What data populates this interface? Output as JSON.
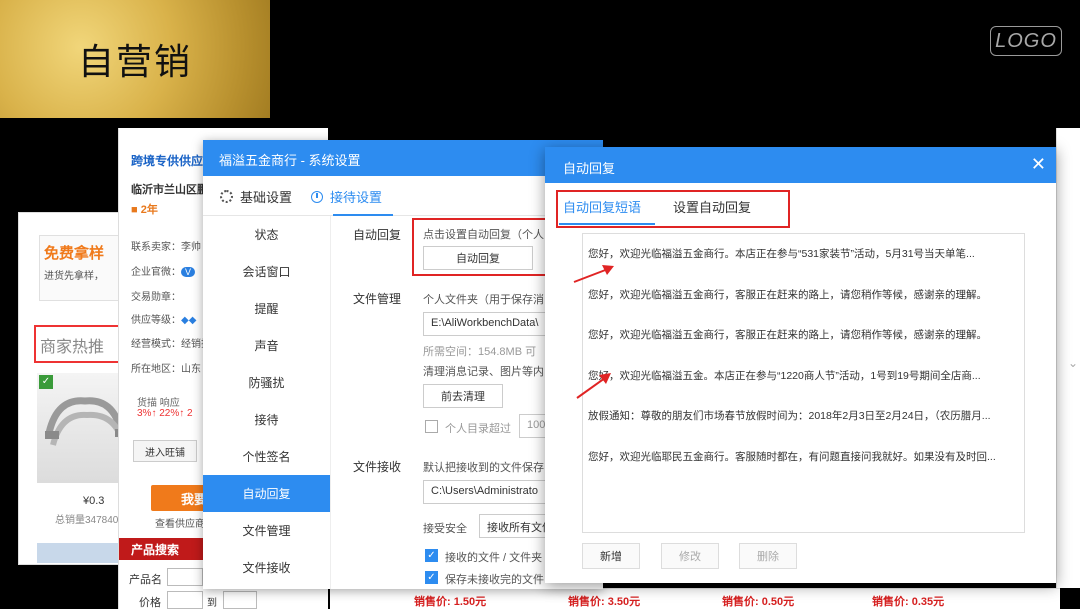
{
  "header": {
    "banner_title": "自营销",
    "logo": "LOGO"
  },
  "left_page": {
    "free_title": "免费拿样",
    "free_sub": "进货先拿样，",
    "hot_label": "商家热推",
    "price": "¥0.3",
    "sold": "总销量347840"
  },
  "supplier": {
    "title": "跨境专供供应",
    "company": "临沂市兰山区鹏",
    "years": "2年",
    "rows": [
      "联系卖家：李帅",
      "企业官微：",
      "交易勋章：",
      "供应等级：",
      "经营模式：经销批",
      "所在地区：山东"
    ],
    "stat_labels": "货描   响应",
    "stat_values": "3%↑  22%↑  2",
    "enter_btn": "进入旺铺",
    "buy_btn": "我要",
    "view_link": "查看供应商",
    "prod_search": "产品搜索",
    "prod_name": "产品名",
    "price_label": "价格",
    "to_label": "到"
  },
  "bottom_prices": [
    "销售价: 1.50元",
    "销售价: 3.50元",
    "销售价: 0.50元",
    "销售价: 0.35元"
  ],
  "sys_dialog": {
    "title": "福溢五金商行 - 系统设置",
    "tabs": [
      "基础设置",
      "接待设置"
    ],
    "nav": [
      "状态",
      "会话窗口",
      "提醒",
      "声音",
      "防骚扰",
      "接待",
      "个性签名",
      "自动回复",
      "文件管理",
      "文件接收"
    ],
    "auto_reply_label": "自动回复",
    "auto_reply_hint": "点击设置自动回复（个人",
    "auto_reply_btn": "自动回复",
    "file_mgmt_label": "文件管理",
    "file_folder_hint": "个人文件夹（用于保存消",
    "file_path": "E:\\AliWorkbenchData\\",
    "space_used": "所需空间：154.8MB   可",
    "clear_hint": "清理消息记录、图片等内",
    "clear_btn": "前去清理",
    "dir_limit": "个人目录超过",
    "dir_limit_value": "100",
    "file_recv_label": "文件接收",
    "recv_hint": "默认把接收到的文件保存",
    "recv_path": "C:\\Users\\Administrato",
    "security_label": "接受安全",
    "security_value": "接收所有文件",
    "check1": "接收的文件 / 文件夹",
    "check2": "保存未接收完的文件"
  },
  "ar_dialog": {
    "title": "自动回复",
    "tabs": [
      "自动回复短语",
      "设置自动回复"
    ],
    "items": [
      "您好，欢迎光临福溢五金商行。本店正在参与“531家装节”活动，5月31号当天单笔...",
      "您好，欢迎光临福溢五金商行，客服正在赶来的路上，请您稍作等候，感谢亲的理解。",
      "您好，欢迎光临福溢五金商行，客服正在赶来的路上，请您稍作等候，感谢亲的理解。",
      "您好，欢迎光临福溢五金。本店正在参与“1220商人节”活动，1号到19号期间全店商...",
      "放假通知：尊敬的朋友们市场春节放假时间为：2018年2月3日至2月24日，（农历腊月...",
      "您好，欢迎光临耶民五金商行。客服随时都在，有问题直接问我就好。如果没有及时回..."
    ],
    "btn_new": "新增",
    "btn_edit": "修改",
    "btn_delete": "删除"
  },
  "colors": {
    "primary_blue": "#2d8cf0",
    "highlight_red": "#e02424",
    "gold": "#d9b24a"
  }
}
